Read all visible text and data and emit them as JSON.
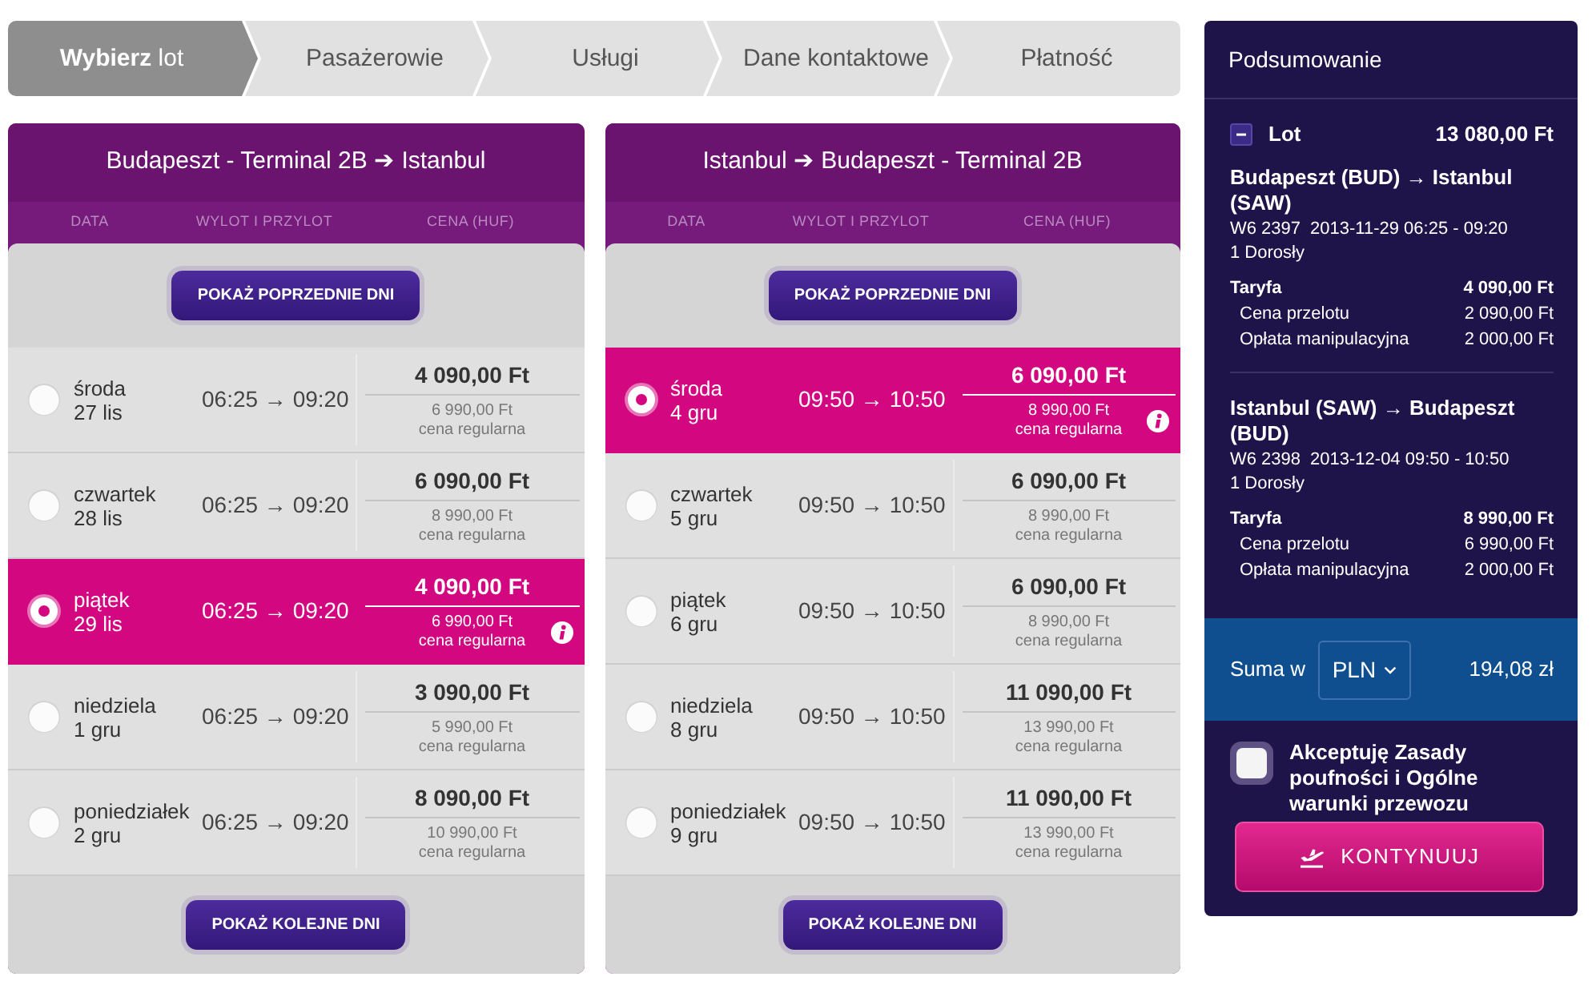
{
  "steps": [
    {
      "label": "**Wybierz** lot",
      "selected": true
    },
    {
      "label": "Pasażerowie",
      "selected": false
    },
    {
      "label": "Usługi",
      "selected": false
    },
    {
      "label": "Dane kontaktowe",
      "selected": false
    },
    {
      "label": "Płatność",
      "selected": false
    }
  ],
  "flights": [
    {
      "title": "Budapeszt - Terminal 2B ➔ Istanbul",
      "columns": [
        "DATA",
        "WYLOT I PRZYLOT",
        "CENA (HUF)"
      ],
      "previous_button": "POKAŻ POPRZEDNIE DNI",
      "days": [
        {
          "weekday": "środa",
          "date": "27 lis",
          "times": "06:25 → 09:20",
          "price": "4 090,00 Ft",
          "regular_price": "6 990,00 Ft",
          "regular_label": "cena regularna",
          "selected": false
        },
        {
          "weekday": "czwartek",
          "date": "28 lis",
          "times": "06:25 → 09:20",
          "price": "6 090,00 Ft",
          "regular_price": "8 990,00 Ft",
          "regular_label": "cena regularna",
          "selected": false
        },
        {
          "weekday": "piątek",
          "date": "29 lis",
          "times": "06:25 → 09:20",
          "price": "4 090,00 Ft",
          "regular_price": "6 990,00 Ft",
          "regular_label": "cena regularna",
          "selected": true
        },
        {
          "weekday": "niedziela",
          "date": "1 gru",
          "times": "06:25 → 09:20",
          "price": "3 090,00 Ft",
          "regular_price": "5 990,00 Ft",
          "regular_label": "cena regularna",
          "selected": false
        },
        {
          "weekday": "poniedziałek",
          "date": "2 gru",
          "times": "06:25 → 09:20",
          "price": "8 090,00 Ft",
          "regular_price": "10 990,00 Ft",
          "regular_label": "cena regularna",
          "selected": false
        }
      ],
      "next_button": "POKAŻ KOLEJNE DNI"
    },
    {
      "title": "Istanbul ➔ Budapeszt - Terminal 2B",
      "columns": [
        "DATA",
        "WYLOT I PRZYLOT",
        "CENA (HUF)"
      ],
      "previous_button": "POKAŻ POPRZEDNIE DNI",
      "days": [
        {
          "weekday": "środa",
          "date": "4 gru",
          "times": "09:50 → 10:50",
          "price": "6 090,00 Ft",
          "regular_price": "8 990,00 Ft",
          "regular_label": "cena regularna",
          "selected": true
        },
        {
          "weekday": "czwartek",
          "date": "5 gru",
          "times": "09:50 → 10:50",
          "price": "6 090,00 Ft",
          "regular_price": "8 990,00 Ft",
          "regular_label": "cena regularna",
          "selected": false
        },
        {
          "weekday": "piątek",
          "date": "6 gru",
          "times": "09:50 → 10:50",
          "price": "6 090,00 Ft",
          "regular_price": "8 990,00 Ft",
          "regular_label": "cena regularna",
          "selected": false
        },
        {
          "weekday": "niedziela",
          "date": "8 gru",
          "times": "09:50 → 10:50",
          "price": "11 090,00 Ft",
          "regular_price": "13 990,00 Ft",
          "regular_label": "cena regularna",
          "selected": false
        },
        {
          "weekday": "poniedziałek",
          "date": "9 gru",
          "times": "09:50 → 10:50",
          "price": "11 090,00 Ft",
          "regular_price": "13 990,00 Ft",
          "regular_label": "cena regularna",
          "selected": false
        }
      ],
      "next_button": "POKAŻ KOLEJNE DNI"
    }
  ],
  "summary": {
    "title": "Podsumowanie",
    "section": {
      "label": "Lot",
      "amount": "13 080,00 Ft",
      "expanded": true
    },
    "segments": [
      {
        "route": "Budapeszt (BUD) → Istanbul (SAW)",
        "flight_number": "W6 2397",
        "schedule": "2013-11-29 06:25 - 09:20",
        "passengers": "1 Dorosły",
        "fare": {
          "label": "Taryfa",
          "amount": "4 090,00 Ft"
        },
        "fees": [
          {
            "label": "Cena przelotu",
            "amount": "2 090,00 Ft"
          },
          {
            "label": "Opłata manipulacyjna",
            "amount": "2 000,00 Ft"
          }
        ]
      },
      {
        "route": "Istanbul (SAW) → Budapeszt (BUD)",
        "flight_number": "W6 2398",
        "schedule": "2013-12-04 09:50 - 10:50",
        "passengers": "1 Dorosły",
        "fare": {
          "label": "Taryfa",
          "amount": "8 990,00 Ft"
        },
        "fees": [
          {
            "label": "Cena przelotu",
            "amount": "6 990,00 Ft"
          },
          {
            "label": "Opłata manipulacyjna",
            "amount": "2 000,00 Ft"
          }
        ]
      }
    ],
    "total": {
      "label": "Suma w",
      "currency": "PLN",
      "amount": "194,08 zł"
    },
    "terms": {
      "text": "Akceptuję Zasady poufności i Ogólne warunki przewozu",
      "checked": false
    },
    "continue_button": "KONTYNUUJ"
  }
}
